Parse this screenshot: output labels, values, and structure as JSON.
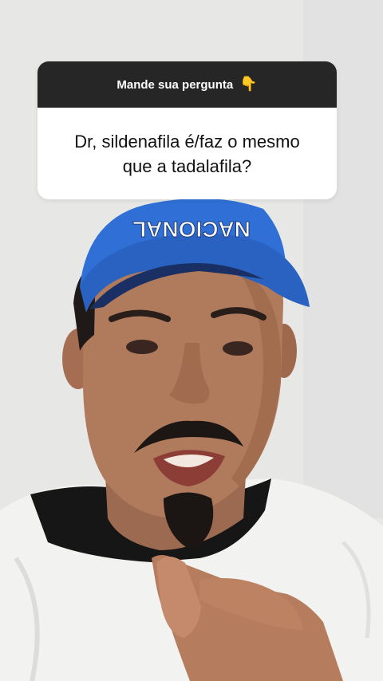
{
  "question_box": {
    "header": "Mande sua pergunta",
    "header_icon": "backhand-index-pointing-down-icon",
    "question": "Dr, sildenafila é/faz o mesmo\nque a tadalafila?"
  },
  "cap": {
    "text": "NACIONAL",
    "color": "#2f6fd6"
  },
  "colors": {
    "card_header": "#262626",
    "card_body": "#ffffff",
    "background_wall": "#e9e9e8",
    "shirt": "#f3f3f1",
    "collar": "#141414"
  }
}
